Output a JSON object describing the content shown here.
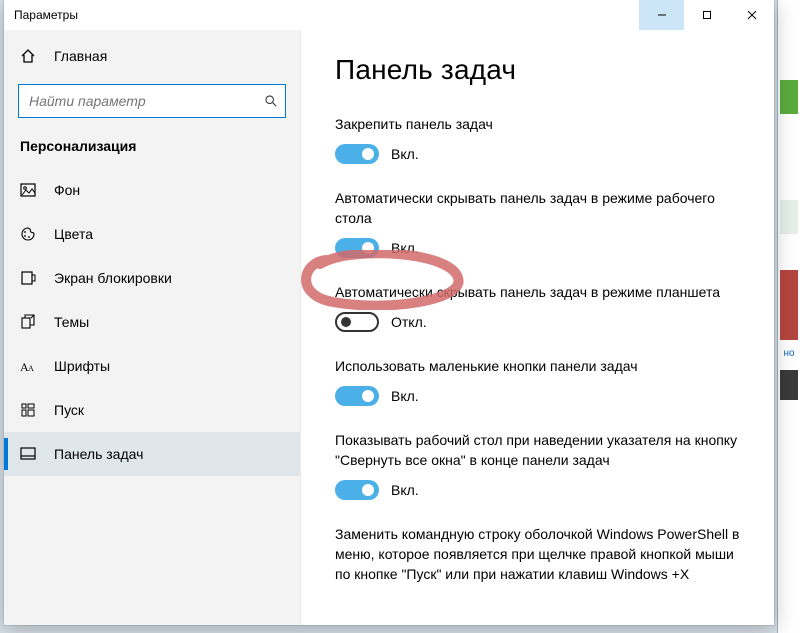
{
  "window": {
    "title": "Параметры",
    "buttons": {
      "min": "—",
      "max": "☐",
      "close": "✕"
    }
  },
  "sidebar": {
    "home": "Главная",
    "search_placeholder": "Найти параметр",
    "section": "Персонализация",
    "items": [
      {
        "key": "background",
        "label": "Фон"
      },
      {
        "key": "colors",
        "label": "Цвета"
      },
      {
        "key": "lockscreen",
        "label": "Экран блокировки"
      },
      {
        "key": "themes",
        "label": "Темы"
      },
      {
        "key": "fonts",
        "label": "Шрифты"
      },
      {
        "key": "start",
        "label": "Пуск"
      },
      {
        "key": "taskbar",
        "label": "Панель задач"
      }
    ],
    "active": "taskbar"
  },
  "content": {
    "heading": "Панель задач",
    "state_on": "Вкл.",
    "state_off": "Откл.",
    "settings": [
      {
        "label": "Закрепить панель задач",
        "value": true
      },
      {
        "label": "Автоматически скрывать панель задач в режиме рабочего стола",
        "value": true
      },
      {
        "label": "Автоматически скрывать панель задач в режиме планшета",
        "value": false
      },
      {
        "label": "Использовать маленькие кнопки панели задач",
        "value": true
      },
      {
        "label": "Показывать рабочий стол при наведении указателя на кнопку \"Свернуть все окна\" в конце панели задач",
        "value": true
      },
      {
        "label": "Заменить командную строку оболочкой Windows PowerShell в меню, которое появляется при щелчке правой кнопкой мыши по кнопке \"Пуск\" или при нажатии клавиш Windows +X",
        "value": null
      }
    ]
  }
}
